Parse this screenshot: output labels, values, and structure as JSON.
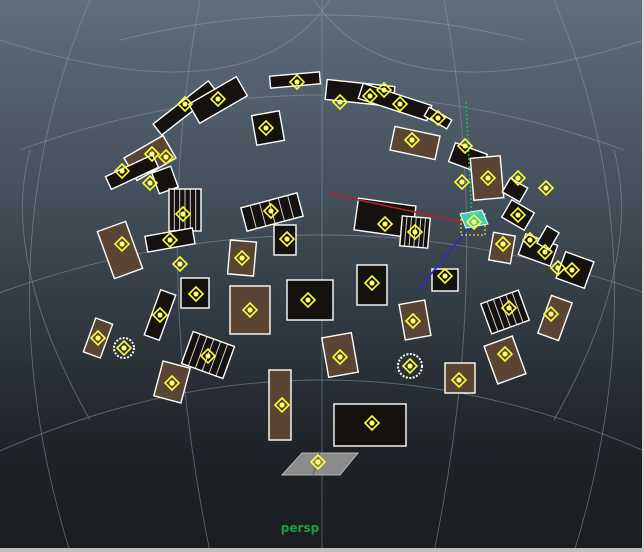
{
  "viewport": {
    "camera_name": "persp",
    "colors": {
      "label": "#19a046",
      "grid": "#8e9aa5",
      "outline": "#ffffff",
      "card_dark": "#15110e",
      "card_warm": "#5a4534",
      "locator": "#ffff33",
      "locator_center": "#ffff66",
      "axis_x": "#b81e2a",
      "axis_y": "#1fb35a",
      "axis_z": "#2430c0",
      "selection": "#45e0c0",
      "floor": "#8b8b8b"
    },
    "icons": [
      "image-plane-locator-icon",
      "camera-node-icon",
      "move-manipulator-icon"
    ]
  }
}
